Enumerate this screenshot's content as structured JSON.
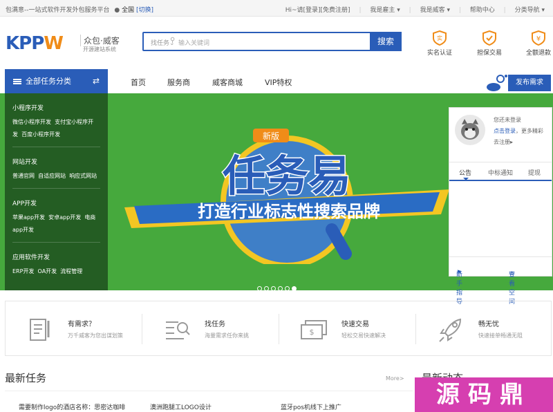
{
  "topbar": {
    "tagline": "包满意--一站式软件开发外包服务平台",
    "location_icon": "map-pin-icon",
    "city": "全国",
    "switch_label": "[切换]",
    "greeting": "Hi~请",
    "login_label": "[登录]",
    "register_label": "[免费注册]",
    "employer_menu": "我是雇主",
    "witkey_menu": "我是威客",
    "help_label": "帮助中心",
    "category_nav": "分类导航"
  },
  "header": {
    "logo_text_kpp": "KPP",
    "logo_text_w": "W",
    "logo_subtitle": "众包·威客",
    "logo_tagline": "开源建站系统",
    "search_category": "找任务",
    "search_placeholder": "输入关键词",
    "search_button": "搜索",
    "badges": [
      {
        "label": "实名认证",
        "icon": "real-name-icon"
      },
      {
        "label": "担保交易",
        "icon": "guarantee-icon"
      },
      {
        "label": "全额退款",
        "icon": "refund-icon"
      }
    ]
  },
  "nav": {
    "category_button": "全部任务分类",
    "items": [
      "首页",
      "服务商",
      "威客商城",
      "VIP特权"
    ],
    "publish_button": "发布需求"
  },
  "sidebar": {
    "categories": [
      {
        "title": "小程序开发",
        "items": [
          "微信小程序开发",
          "支付宝小程序开发",
          "百度小程序开发"
        ]
      },
      {
        "title": "网站开发",
        "items": [
          "普通官网",
          "自适应网站",
          "响应式网站"
        ]
      },
      {
        "title": "APP开发",
        "items": [
          "苹果app开发",
          "安卓app开发",
          "电商app开发"
        ]
      },
      {
        "title": "应用软件开发",
        "items": [
          "ERP开发",
          "OA开发",
          "流程管理"
        ]
      }
    ]
  },
  "banner": {
    "badge": "新版",
    "title": "任务易",
    "slogan": "打造行业标志性搜索品牌",
    "bg_color": "#46a93d",
    "dots": 6,
    "active_dot": 6
  },
  "userbox": {
    "not_logged": "您还未登录",
    "login_link": "点击登录",
    "more_text": "，更多精彩",
    "register_link": "去注册",
    "tabs": [
      "公告",
      "中标通知",
      "提现"
    ],
    "guide": "新手指导",
    "space": "查看空间"
  },
  "features": [
    {
      "title": "有需求？",
      "desc": "万千威客为您出谋划策",
      "icon": "document-icon"
    },
    {
      "title": "找任务",
      "desc": "海量需求任你来挑",
      "icon": "search-list-icon"
    },
    {
      "title": "快速交易",
      "desc": "轻松交易快速解决",
      "icon": "money-icon"
    },
    {
      "title": "畅无忧",
      "desc": "快速接单畅通无阻",
      "icon": "rocket-icon"
    }
  ],
  "latest": {
    "title": "最新任务",
    "more": "More>",
    "dynamics_title": "最新动态",
    "tasks": [
      "需要制作logo的酒店名称：思密达咖啡",
      "澳洲跑腿工LOGO设计",
      "蓝牙pos机线下上推广"
    ]
  },
  "watermark": "源码鼎",
  "colors": {
    "primary": "#2a5db8",
    "accent": "#f08c18",
    "green": "#46a93d"
  }
}
